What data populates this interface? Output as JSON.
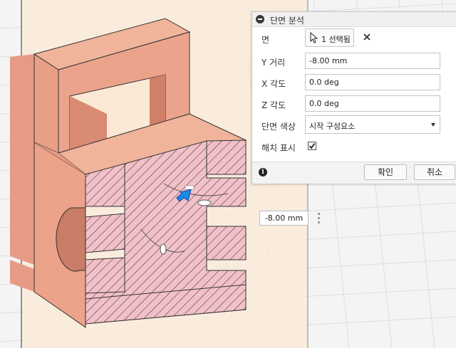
{
  "colors": {
    "part_face": "#f0b49a",
    "part_side": "#e89a80",
    "part_dark": "#c97c66",
    "section_fill": "#f2c0c8",
    "plane": "#fbe9d6",
    "grid": "#d8d8d8"
  },
  "panel": {
    "title": "단면 분석",
    "face": {
      "label": "면",
      "button": "1 선택됨",
      "cursor_icon": "cursor-icon",
      "clear_icon": "close-icon"
    },
    "y_distance": {
      "label": "Y 거리",
      "value": "-8.00 mm"
    },
    "x_angle": {
      "label": "X 각도",
      "value": "0.0 deg"
    },
    "z_angle": {
      "label": "Z 각도",
      "value": "0.0 deg"
    },
    "section_color": {
      "label": "단면 색상",
      "value": "시작 구성요소"
    },
    "hatch": {
      "label": "해치 표시",
      "checked": true
    },
    "ok": "확인",
    "cancel": "취소"
  },
  "viewport": {
    "distance_tag": "-8.00 mm"
  }
}
